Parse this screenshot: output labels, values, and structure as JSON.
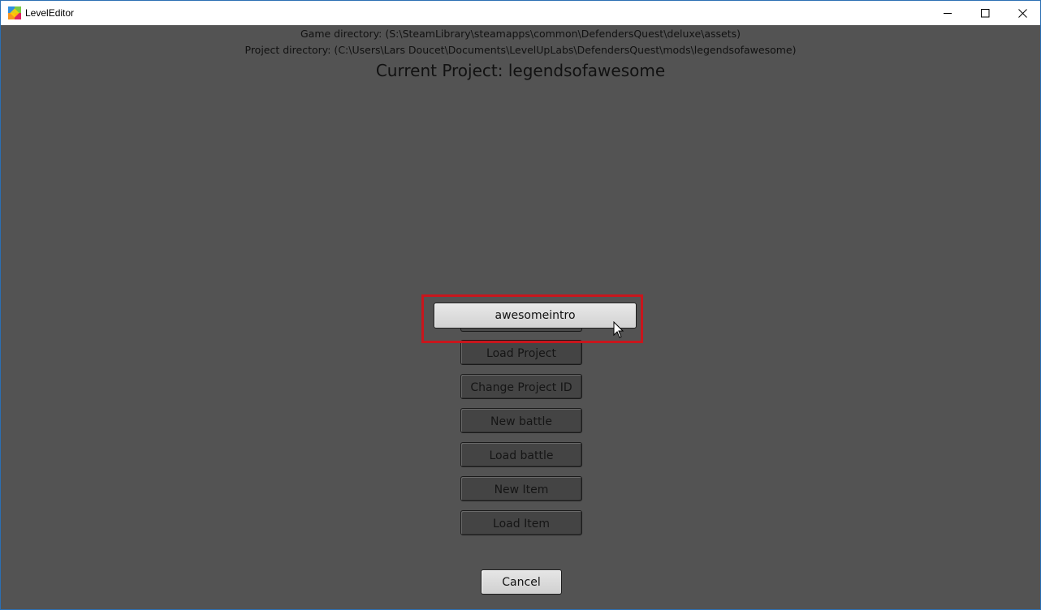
{
  "window": {
    "title": "LevelEditor",
    "controls": [
      "minimize",
      "maximize",
      "close"
    ]
  },
  "info": {
    "game_directory": "Game directory: (S:\\SteamLibrary\\steamapps\\common\\DefendersQuest\\deluxe\\assets)",
    "project_directory": "Project directory: (C:\\Users\\Lars Doucet\\Documents\\LevelUpLabs\\DefendersQuest\\mods\\legendsofawesome)",
    "current_project": "Current Project: legendsofawesome"
  },
  "dropdown": {
    "selected_value": "awesomeintro"
  },
  "menu": {
    "load_project": "Load Project",
    "change_project_id": "Change Project ID",
    "new_battle": "New battle",
    "load_battle": "Load battle",
    "new_item": "New Item",
    "load_item": "Load Item"
  },
  "footer": {
    "cancel_label": "Cancel"
  },
  "colors": {
    "background": "#535353",
    "highlight": "#c8161d",
    "button_dark": "#444444",
    "button_light": "#dcdcdc"
  }
}
